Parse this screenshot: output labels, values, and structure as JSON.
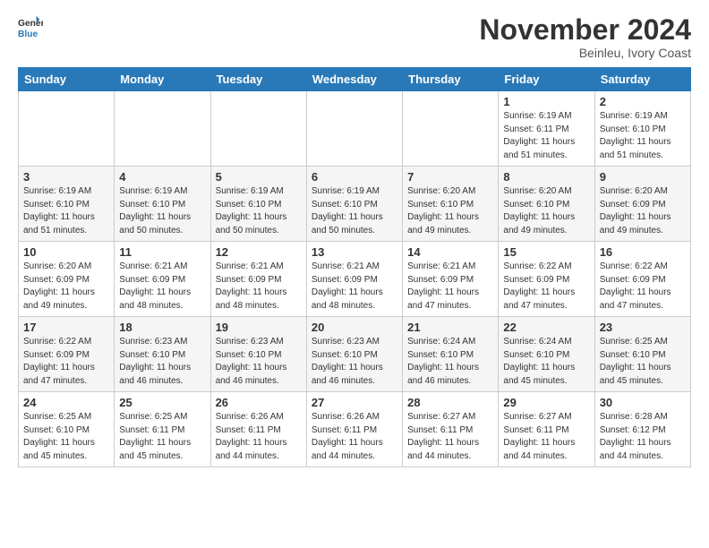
{
  "logo": {
    "line1": "General",
    "line2": "Blue"
  },
  "header": {
    "month": "November 2024",
    "location": "Beinleu, Ivory Coast"
  },
  "weekdays": [
    "Sunday",
    "Monday",
    "Tuesday",
    "Wednesday",
    "Thursday",
    "Friday",
    "Saturday"
  ],
  "weeks": [
    [
      {
        "day": "",
        "info": ""
      },
      {
        "day": "",
        "info": ""
      },
      {
        "day": "",
        "info": ""
      },
      {
        "day": "",
        "info": ""
      },
      {
        "day": "",
        "info": ""
      },
      {
        "day": "1",
        "info": "Sunrise: 6:19 AM\nSunset: 6:11 PM\nDaylight: 11 hours\nand 51 minutes."
      },
      {
        "day": "2",
        "info": "Sunrise: 6:19 AM\nSunset: 6:10 PM\nDaylight: 11 hours\nand 51 minutes."
      }
    ],
    [
      {
        "day": "3",
        "info": "Sunrise: 6:19 AM\nSunset: 6:10 PM\nDaylight: 11 hours\nand 51 minutes."
      },
      {
        "day": "4",
        "info": "Sunrise: 6:19 AM\nSunset: 6:10 PM\nDaylight: 11 hours\nand 50 minutes."
      },
      {
        "day": "5",
        "info": "Sunrise: 6:19 AM\nSunset: 6:10 PM\nDaylight: 11 hours\nand 50 minutes."
      },
      {
        "day": "6",
        "info": "Sunrise: 6:19 AM\nSunset: 6:10 PM\nDaylight: 11 hours\nand 50 minutes."
      },
      {
        "day": "7",
        "info": "Sunrise: 6:20 AM\nSunset: 6:10 PM\nDaylight: 11 hours\nand 49 minutes."
      },
      {
        "day": "8",
        "info": "Sunrise: 6:20 AM\nSunset: 6:10 PM\nDaylight: 11 hours\nand 49 minutes."
      },
      {
        "day": "9",
        "info": "Sunrise: 6:20 AM\nSunset: 6:09 PM\nDaylight: 11 hours\nand 49 minutes."
      }
    ],
    [
      {
        "day": "10",
        "info": "Sunrise: 6:20 AM\nSunset: 6:09 PM\nDaylight: 11 hours\nand 49 minutes."
      },
      {
        "day": "11",
        "info": "Sunrise: 6:21 AM\nSunset: 6:09 PM\nDaylight: 11 hours\nand 48 minutes."
      },
      {
        "day": "12",
        "info": "Sunrise: 6:21 AM\nSunset: 6:09 PM\nDaylight: 11 hours\nand 48 minutes."
      },
      {
        "day": "13",
        "info": "Sunrise: 6:21 AM\nSunset: 6:09 PM\nDaylight: 11 hours\nand 48 minutes."
      },
      {
        "day": "14",
        "info": "Sunrise: 6:21 AM\nSunset: 6:09 PM\nDaylight: 11 hours\nand 47 minutes."
      },
      {
        "day": "15",
        "info": "Sunrise: 6:22 AM\nSunset: 6:09 PM\nDaylight: 11 hours\nand 47 minutes."
      },
      {
        "day": "16",
        "info": "Sunrise: 6:22 AM\nSunset: 6:09 PM\nDaylight: 11 hours\nand 47 minutes."
      }
    ],
    [
      {
        "day": "17",
        "info": "Sunrise: 6:22 AM\nSunset: 6:09 PM\nDaylight: 11 hours\nand 47 minutes."
      },
      {
        "day": "18",
        "info": "Sunrise: 6:23 AM\nSunset: 6:10 PM\nDaylight: 11 hours\nand 46 minutes."
      },
      {
        "day": "19",
        "info": "Sunrise: 6:23 AM\nSunset: 6:10 PM\nDaylight: 11 hours\nand 46 minutes."
      },
      {
        "day": "20",
        "info": "Sunrise: 6:23 AM\nSunset: 6:10 PM\nDaylight: 11 hours\nand 46 minutes."
      },
      {
        "day": "21",
        "info": "Sunrise: 6:24 AM\nSunset: 6:10 PM\nDaylight: 11 hours\nand 46 minutes."
      },
      {
        "day": "22",
        "info": "Sunrise: 6:24 AM\nSunset: 6:10 PM\nDaylight: 11 hours\nand 45 minutes."
      },
      {
        "day": "23",
        "info": "Sunrise: 6:25 AM\nSunset: 6:10 PM\nDaylight: 11 hours\nand 45 minutes."
      }
    ],
    [
      {
        "day": "24",
        "info": "Sunrise: 6:25 AM\nSunset: 6:10 PM\nDaylight: 11 hours\nand 45 minutes."
      },
      {
        "day": "25",
        "info": "Sunrise: 6:25 AM\nSunset: 6:11 PM\nDaylight: 11 hours\nand 45 minutes."
      },
      {
        "day": "26",
        "info": "Sunrise: 6:26 AM\nSunset: 6:11 PM\nDaylight: 11 hours\nand 44 minutes."
      },
      {
        "day": "27",
        "info": "Sunrise: 6:26 AM\nSunset: 6:11 PM\nDaylight: 11 hours\nand 44 minutes."
      },
      {
        "day": "28",
        "info": "Sunrise: 6:27 AM\nSunset: 6:11 PM\nDaylight: 11 hours\nand 44 minutes."
      },
      {
        "day": "29",
        "info": "Sunrise: 6:27 AM\nSunset: 6:11 PM\nDaylight: 11 hours\nand 44 minutes."
      },
      {
        "day": "30",
        "info": "Sunrise: 6:28 AM\nSunset: 6:12 PM\nDaylight: 11 hours\nand 44 minutes."
      }
    ]
  ]
}
